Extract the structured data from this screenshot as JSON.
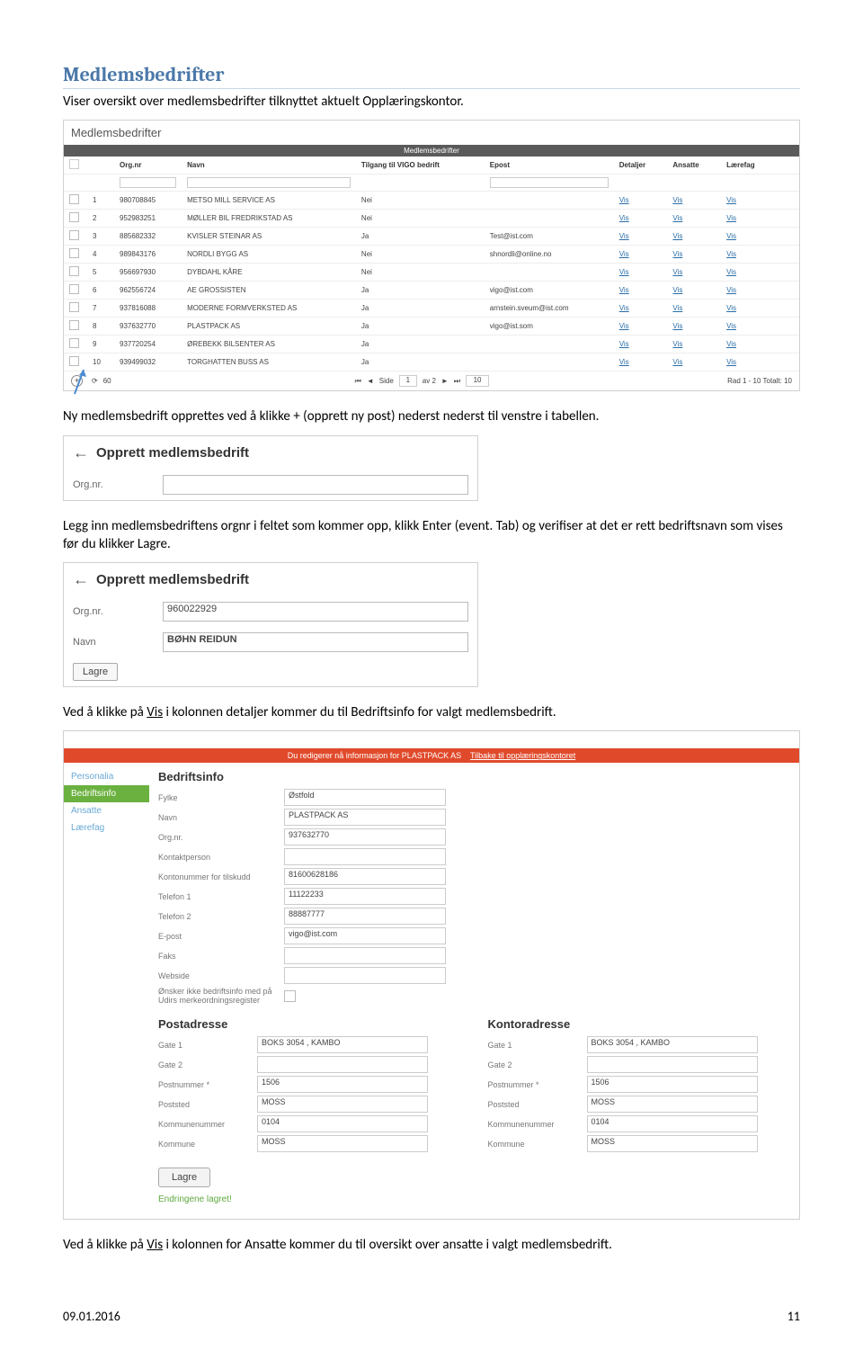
{
  "heading": "Medlemsbedrifter",
  "para1": "Viser oversikt over medlemsbedrifter tilknyttet aktuelt Opplæringskontor.",
  "para2": "Ny medlemsbedrift opprettes ved å klikke + (opprett ny post) nederst nederst til venstre i tabellen.",
  "para3a": "Legg inn medlemsbedriftens orgnr i feltet som kommer opp, klikk Enter (event. Tab) og verifiser at det er rett bedriftsnavn som vises før du klikker Lagre.",
  "para4a": "Ved å klikke på ",
  "para4b": "Vis",
  "para4c": " i kolonnen detaljer kommer du til Bedriftsinfo for valgt medlemsbedrift.",
  "para5a": "Ved å klikke på ",
  "para5b": "Vis",
  "para5c": " i kolonnen for Ansatte kommer du til oversikt over ansatte i valgt medlemsbedrift.",
  "shot1": {
    "title": "Medlemsbedrifter",
    "band": "Medlemsbedrifter",
    "cols": [
      "",
      "Org.nr",
      "Navn",
      "Tilgang til VIGO bedrift",
      "Epost",
      "Detaljer",
      "Ansatte",
      "Lærefag"
    ],
    "rows": [
      {
        "n": "1",
        "org": "980708845",
        "navn": "METSO MILL SERVICE AS",
        "til": "Nei",
        "ep": ""
      },
      {
        "n": "2",
        "org": "952983251",
        "navn": "MØLLER BIL FREDRIKSTAD AS",
        "til": "Nei",
        "ep": ""
      },
      {
        "n": "3",
        "org": "885682332",
        "navn": "KVISLER STEINAR AS",
        "til": "Ja",
        "ep": "Test@ist.com"
      },
      {
        "n": "4",
        "org": "989843176",
        "navn": "NORDLI BYGG AS",
        "til": "Nei",
        "ep": "shnordli@online.no"
      },
      {
        "n": "5",
        "org": "956697930",
        "navn": "DYBDAHL KÅRE",
        "til": "Nei",
        "ep": ""
      },
      {
        "n": "6",
        "org": "962556724",
        "navn": "AE GROSSISTEN",
        "til": "Ja",
        "ep": "vigo@ist.com"
      },
      {
        "n": "7",
        "org": "937816088",
        "navn": "MODERNE FORMVERKSTED AS",
        "til": "Ja",
        "ep": "arnstein.sveum@ist.com"
      },
      {
        "n": "8",
        "org": "937632770",
        "navn": "PLASTPACK AS",
        "til": "Ja",
        "ep": "vigo@ist.som"
      },
      {
        "n": "9",
        "org": "937720254",
        "navn": "ØREBEKK BILSENTER AS",
        "til": "Ja",
        "ep": ""
      },
      {
        "n": "10",
        "org": "939499032",
        "navn": "TORGHATTEN BUSS AS",
        "til": "Ja",
        "ep": ""
      }
    ],
    "vis": "Vis",
    "pager_side": "Side",
    "pager_av": "av 2",
    "pager_page": "1",
    "pager_size": "10",
    "pager_refresh": "60",
    "pager_total": "Rad 1 - 10  Totalt: 10"
  },
  "shot2": {
    "title": "Opprett medlemsbedrift",
    "label_org": "Org.nr."
  },
  "shot3": {
    "title": "Opprett medlemsbedrift",
    "label_org": "Org.nr.",
    "val_org": "960022929",
    "label_navn": "Navn",
    "val_navn": "BØHN REIDUN",
    "lagre": "Lagre"
  },
  "shot4": {
    "bar_a": "Du redigerer nå informasjon for PLASTPACK AS",
    "bar_b": "Tilbake til opplæringskontoret",
    "side": {
      "personalia": "Personalia",
      "bedriftsinfo": "Bedriftsinfo",
      "ansatte": "Ansatte",
      "laerefag": "Lærefag"
    },
    "h_bedriftsinfo": "Bedriftsinfo",
    "fields": {
      "fylke_l": "Fylke",
      "fylke_v": "Østfold",
      "navn_l": "Navn",
      "navn_v": "PLASTPACK AS",
      "org_l": "Org.nr.",
      "org_v": "937632770",
      "kontakt_l": "Kontaktperson",
      "kontakt_v": "",
      "konto_l": "Kontonummer for tilskudd",
      "konto_v": "81600628186",
      "tel1_l": "Telefon 1",
      "tel1_v": "11122233",
      "tel2_l": "Telefon 2",
      "tel2_v": "88887777",
      "epost_l": "E-post",
      "epost_v": "vigo@ist.com",
      "faks_l": "Faks",
      "faks_v": "",
      "web_l": "Webside",
      "web_v": "",
      "merke_l": "Ønsker ikke bedriftsinfo med på Udirs merkeordningsregister"
    },
    "h_post": "Postadresse",
    "h_kontor": "Kontoradresse",
    "addr_labels": {
      "g1": "Gate 1",
      "g2": "Gate 2",
      "pn": "Postnummer *",
      "ps": "Poststed",
      "kn": "Kommunenummer",
      "km": "Kommune"
    },
    "post": {
      "g1": "BOKS 3054 , KAMBO",
      "g2": "",
      "pn": "1506",
      "ps": "MOSS",
      "kn": "0104",
      "km": "MOSS"
    },
    "kontor": {
      "g1": "BOKS 3054 , KAMBO",
      "g2": "",
      "pn": "1506",
      "ps": "MOSS",
      "kn": "0104",
      "km": "MOSS"
    },
    "lagre": "Lagre",
    "saved": "Endringene lagret!"
  },
  "footer": {
    "date": "09.01.2016",
    "page": "11"
  }
}
